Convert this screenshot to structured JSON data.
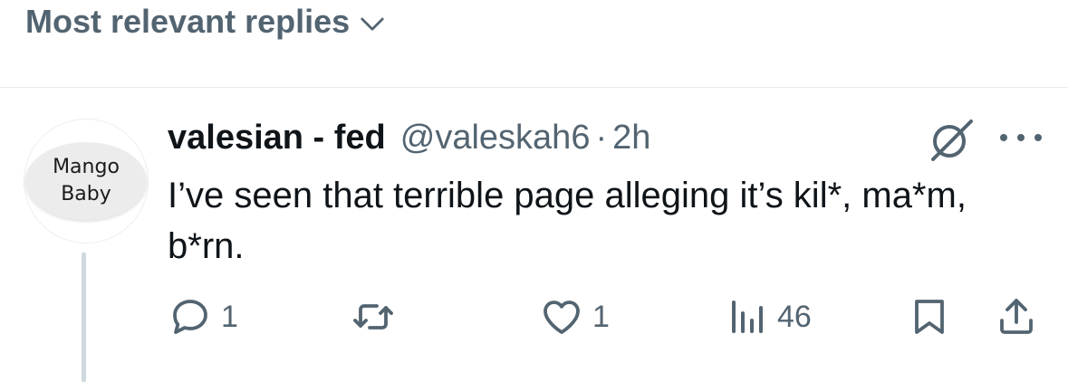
{
  "sort": {
    "label": "Most relevant replies"
  },
  "reply": {
    "avatar": {
      "line1": "Mango",
      "line2": "Baby"
    },
    "display_name": "valesian - fed",
    "handle": "@valeskah6",
    "separator": "·",
    "time": "2h",
    "text": "I’ve seen that terrible page alleging it’s kil*, ma*m, b*rn.",
    "stats": {
      "replies": "1",
      "likes": "1",
      "views": "46"
    }
  },
  "colors": {
    "text": "#0f1419",
    "muted": "#536471",
    "divider": "#e6e9ec",
    "thread_line": "#cfd9de"
  },
  "icons": [
    "chevron-down-icon",
    "grok-icon",
    "more-icon",
    "reply-icon",
    "repost-icon",
    "like-icon",
    "views-icon",
    "bookmark-icon",
    "share-icon"
  ]
}
